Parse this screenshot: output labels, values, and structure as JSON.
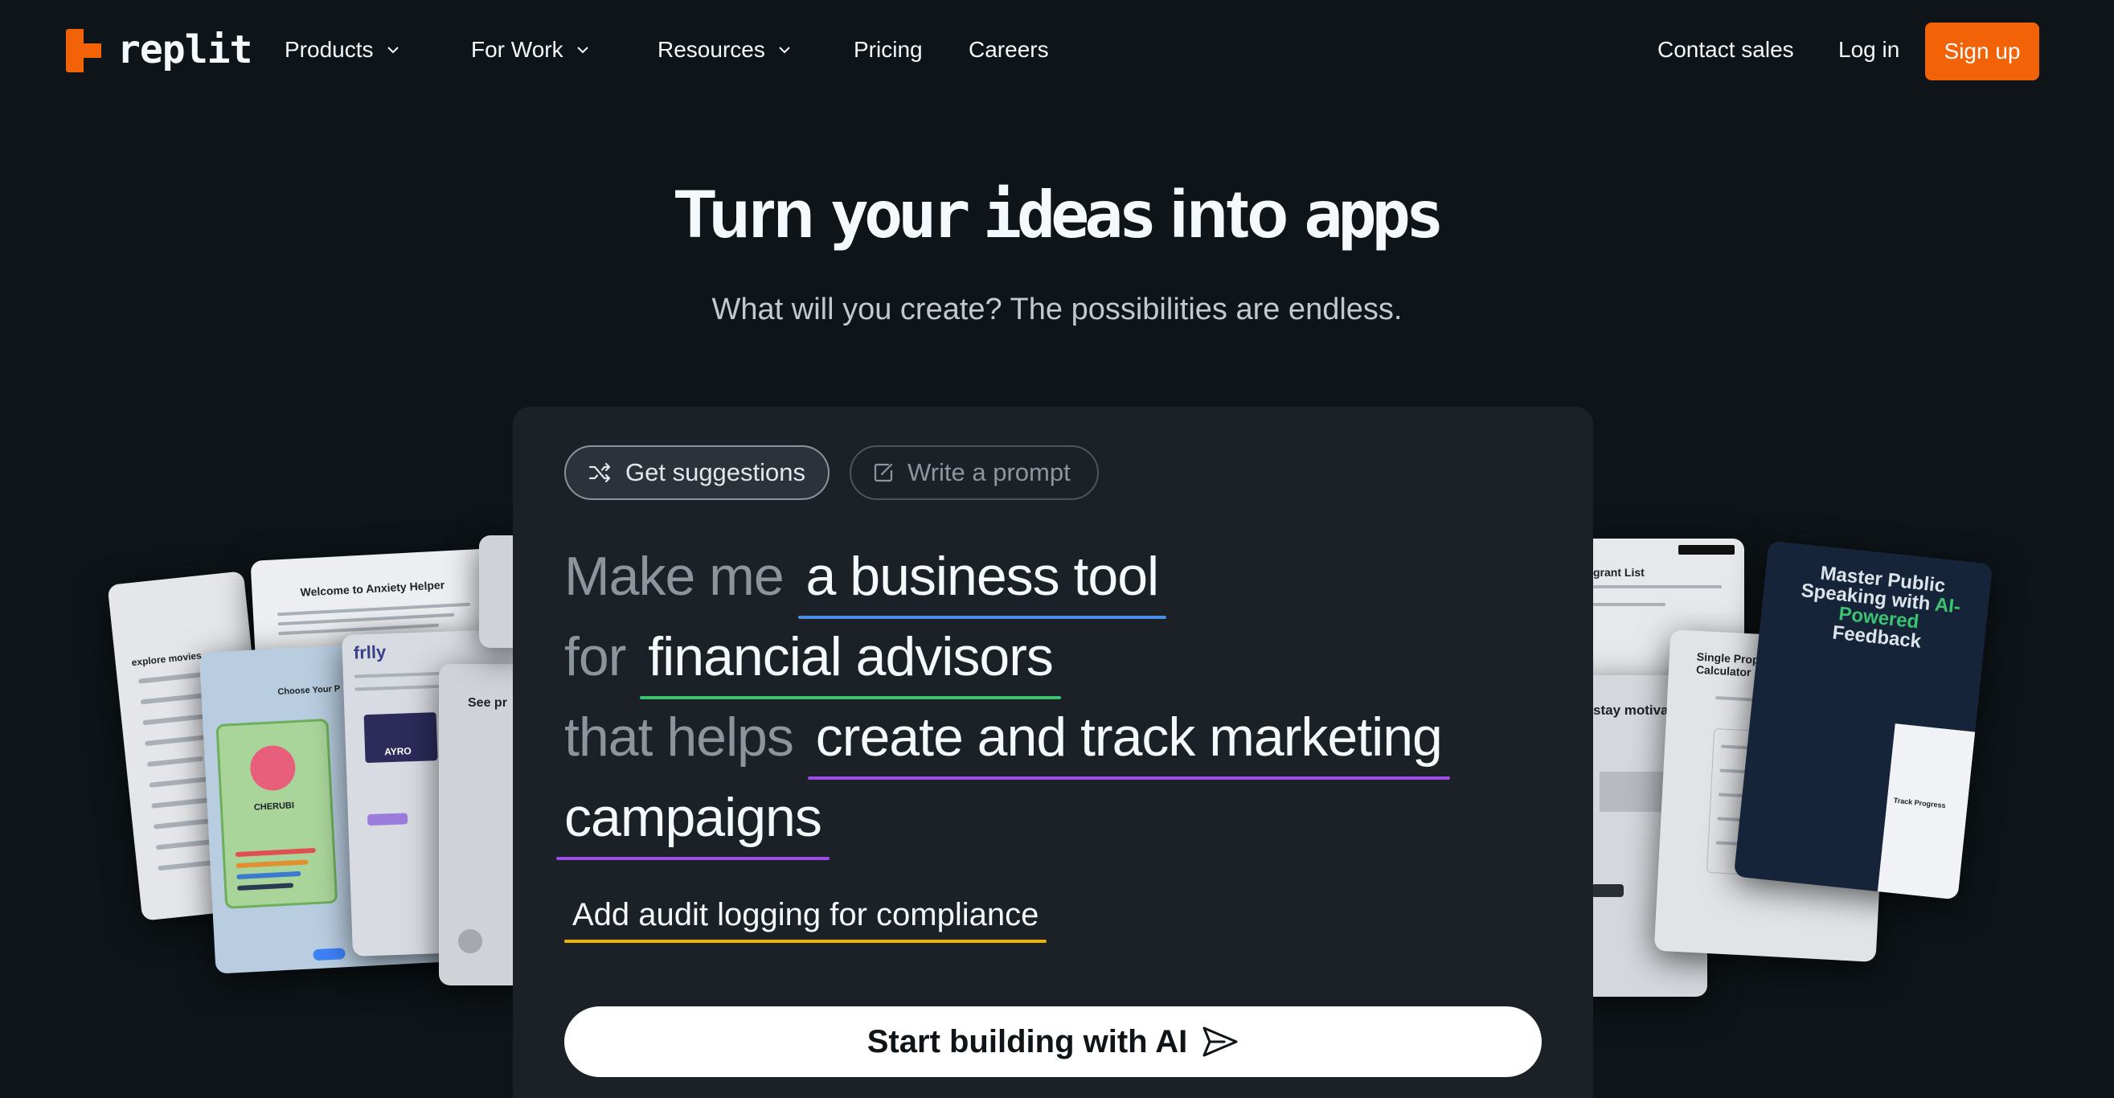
{
  "nav": {
    "logo_text": "replit",
    "products": "Products",
    "for_work": "For Work",
    "resources": "Resources",
    "pricing": "Pricing",
    "careers": "Careers",
    "contact_sales": "Contact sales",
    "log_in": "Log in",
    "sign_up": "Sign up"
  },
  "hero": {
    "title_part1": "Turn ",
    "title_mono1": "your",
    "title_part2": " ",
    "title_mono2": "ideas",
    "title_part3": " into ",
    "title_mono3": "apps",
    "subtitle": "What will you create? The possibilities are endless."
  },
  "prompt": {
    "tab_suggestions": "Get suggestions",
    "tab_write": "Write a prompt",
    "line1_prefix": "Make me",
    "line1_value": "a business tool",
    "line2_prefix": "for",
    "line2_value": "financial advisors",
    "line3_prefix": "that helps",
    "line3_value": "create and track marketing",
    "line4_value": "campaigns",
    "extra_feature": "Add audit logging for compliance",
    "cta": "Start building with AI"
  },
  "preview_cards": {
    "anxiety": "Welcome to Anxiety Helper",
    "movies": "explore movies",
    "pokemon": "Choose Your P",
    "cherubi": "CHERUBI",
    "fnlly": "frlly",
    "ayro": "AYRO",
    "see": "See pr",
    "grant": "grant List",
    "motivated": "stay motivated",
    "loan": "Single Property Loan Calculator",
    "speaking_1": "Master Public Speaking with",
    "speaking_2": "AI-Powered",
    "speaking_3": "Feedback",
    "track": "Track Progress"
  },
  "colors": {
    "accent": "#f26207",
    "underline_blue": "#4a8ee8",
    "underline_green": "#3bc371",
    "underline_purple": "#9c4ee6",
    "underline_yellow": "#f0b400"
  }
}
